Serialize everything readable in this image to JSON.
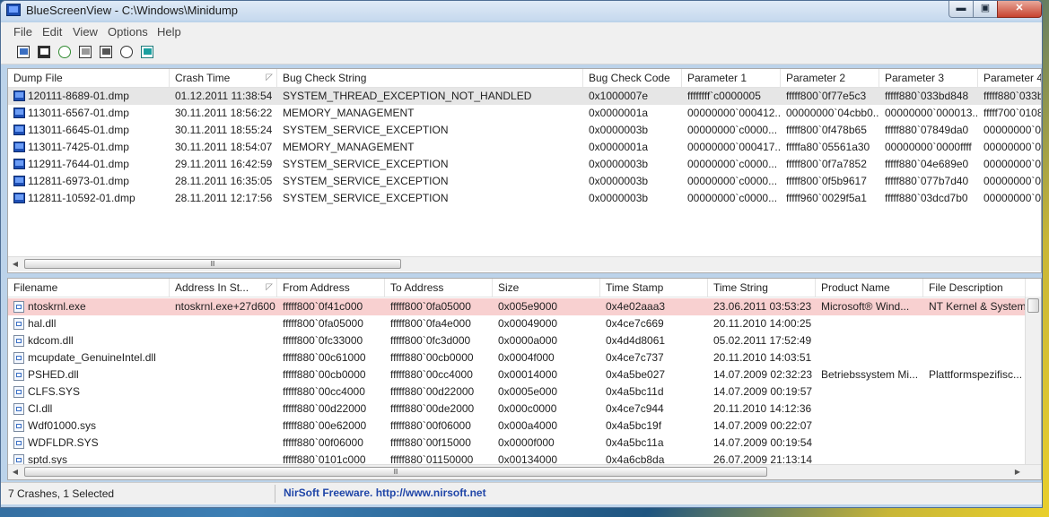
{
  "window": {
    "title": "BlueScreenView  -  C:\\Windows\\Minidump",
    "min_glyph": "▬",
    "max_glyph": "▣",
    "close_glyph": "✕"
  },
  "menu": [
    "File",
    "Edit",
    "View",
    "Options",
    "Help"
  ],
  "toolbar_icons": [
    "properties-icon",
    "save-icon",
    "refresh-icon",
    "copy-icon",
    "options-icon",
    "find-icon",
    "exit-icon"
  ],
  "crash_table": {
    "columns": [
      "Dump File",
      "Crash Time",
      "Bug Check String",
      "Bug Check Code",
      "Parameter 1",
      "Parameter 2",
      "Parameter 3",
      "Parameter 4"
    ],
    "sort_indicator": "◸",
    "rows": [
      [
        "120111-8689-01.dmp",
        "01.12.2011 11:38:54",
        "SYSTEM_THREAD_EXCEPTION_NOT_HANDLED",
        "0x1000007e",
        "ffffffff`c0000005",
        "fffff800`0f77e5c3",
        "fffff880`033bd848",
        "fffff880`033b"
      ],
      [
        "113011-6567-01.dmp",
        "30.11.2011 18:56:22",
        "MEMORY_MANAGEMENT",
        "0x0000001a",
        "00000000`000412...",
        "00000000`04cbb0...",
        "00000000`000013...",
        "fffff700`0108"
      ],
      [
        "113011-6645-01.dmp",
        "30.11.2011 18:55:24",
        "SYSTEM_SERVICE_EXCEPTION",
        "0x0000003b",
        "00000000`c0000...",
        "fffff800`0f478b65",
        "fffff880`07849da0",
        "00000000`000"
      ],
      [
        "113011-7425-01.dmp",
        "30.11.2011 18:54:07",
        "MEMORY_MANAGEMENT",
        "0x0000001a",
        "00000000`000417...",
        "fffffa80`05561a30",
        "00000000`0000ffff",
        "00000000`000"
      ],
      [
        "112911-7644-01.dmp",
        "29.11.2011 16:42:59",
        "SYSTEM_SERVICE_EXCEPTION",
        "0x0000003b",
        "00000000`c0000...",
        "fffff800`0f7a7852",
        "fffff880`04e689e0",
        "00000000`000"
      ],
      [
        "112811-6973-01.dmp",
        "28.11.2011 16:35:05",
        "SYSTEM_SERVICE_EXCEPTION",
        "0x0000003b",
        "00000000`c0000...",
        "fffff800`0f5b9617",
        "fffff880`077b7d40",
        "00000000`000"
      ],
      [
        "112811-10592-01.dmp",
        "28.11.2011 12:17:56",
        "SYSTEM_SERVICE_EXCEPTION",
        "0x0000003b",
        "00000000`c0000...",
        "fffff960`0029f5a1",
        "fffff880`03dcd7b0",
        "00000000`000"
      ]
    ]
  },
  "driver_table": {
    "columns": [
      "Filename",
      "Address In St...",
      "From Address",
      "To Address",
      "Size",
      "Time Stamp",
      "Time String",
      "Product Name",
      "File Description"
    ],
    "sort_indicator": "◸",
    "rows": [
      [
        "ntoskrnl.exe",
        "ntoskrnl.exe+27d600",
        "fffff800`0f41c000",
        "fffff800`0fa05000",
        "0x005e9000",
        "0x4e02aaa3",
        "23.06.2011 03:53:23",
        "Microsoft® Wind...",
        "NT Kernel & System"
      ],
      [
        "hal.dll",
        "",
        "fffff800`0fa05000",
        "fffff800`0fa4e000",
        "0x00049000",
        "0x4ce7c669",
        "20.11.2010 14:00:25",
        "",
        ""
      ],
      [
        "kdcom.dll",
        "",
        "fffff800`0fc33000",
        "fffff800`0fc3d000",
        "0x0000a000",
        "0x4d4d8061",
        "05.02.2011 17:52:49",
        "",
        ""
      ],
      [
        "mcupdate_GenuineIntel.dll",
        "",
        "fffff880`00c61000",
        "fffff880`00cb0000",
        "0x0004f000",
        "0x4ce7c737",
        "20.11.2010 14:03:51",
        "",
        ""
      ],
      [
        "PSHED.dll",
        "",
        "fffff880`00cb0000",
        "fffff880`00cc4000",
        "0x00014000",
        "0x4a5be027",
        "14.07.2009 02:32:23",
        "Betriebssystem Mi...",
        "Plattformspezifisc..."
      ],
      [
        "CLFS.SYS",
        "",
        "fffff880`00cc4000",
        "fffff880`00d22000",
        "0x0005e000",
        "0x4a5bc11d",
        "14.07.2009 00:19:57",
        "",
        ""
      ],
      [
        "CI.dll",
        "",
        "fffff880`00d22000",
        "fffff880`00de2000",
        "0x000c0000",
        "0x4ce7c944",
        "20.11.2010 14:12:36",
        "",
        ""
      ],
      [
        "Wdf01000.sys",
        "",
        "fffff880`00e62000",
        "fffff880`00f06000",
        "0x000a4000",
        "0x4a5bc19f",
        "14.07.2009 00:22:07",
        "",
        ""
      ],
      [
        "WDFLDR.SYS",
        "",
        "fffff880`00f06000",
        "fffff880`00f15000",
        "0x0000f000",
        "0x4a5bc11a",
        "14.07.2009 00:19:54",
        "",
        ""
      ],
      [
        "sptd.sys",
        "",
        "fffff880`0101c000",
        "fffff880`01150000",
        "0x00134000",
        "0x4a6cb8da",
        "26.07.2009 21:13:14",
        "",
        ""
      ]
    ]
  },
  "scroll": {
    "grip": "Ⅲ",
    "left": "◀",
    "right": "▶"
  },
  "status": {
    "summary": "7 Crashes, 1 Selected",
    "link": "NirSoft Freeware.  http://www.nirsoft.net"
  }
}
